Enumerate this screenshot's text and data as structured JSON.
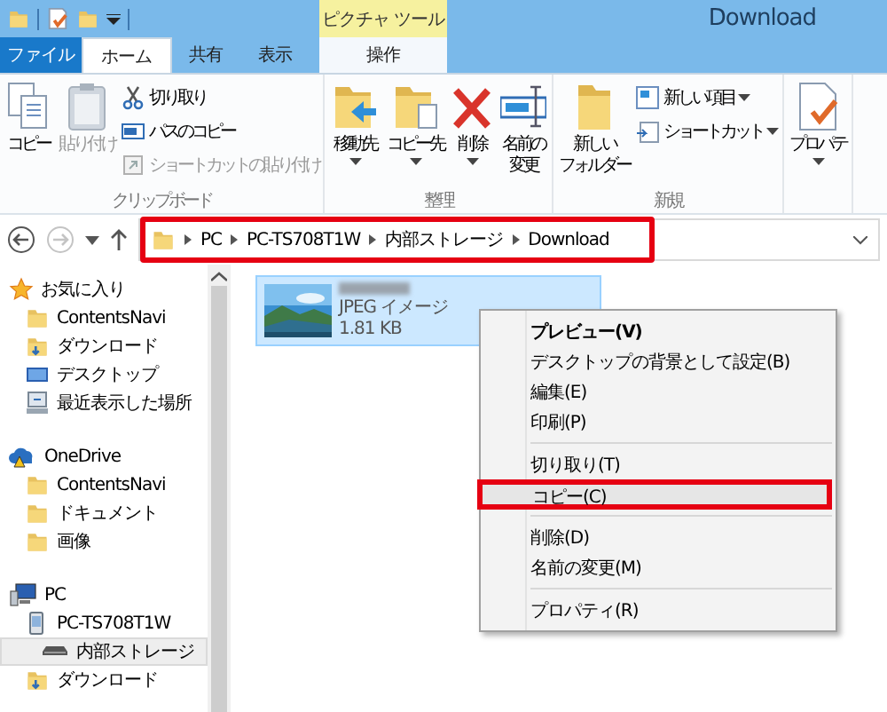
{
  "title_bar": {
    "title": "Download",
    "context_group": "ピクチャ ツール"
  },
  "tabs": [
    {
      "label": "ファイル",
      "kind": "file",
      "selected": false
    },
    {
      "label": "ホーム",
      "kind": "normal",
      "selected": true
    },
    {
      "label": "共有",
      "kind": "normal",
      "selected": false
    },
    {
      "label": "表示",
      "kind": "normal",
      "selected": false
    },
    {
      "label": "操作",
      "kind": "contextual",
      "selected": false
    }
  ],
  "ribbon": {
    "groups": [
      {
        "label": "クリップボード",
        "items": [
          {
            "label": "コピー",
            "kind": "large",
            "disabled": false,
            "has_menu": false
          },
          {
            "label": "貼り付け",
            "kind": "large",
            "disabled": true,
            "has_menu": false
          },
          {
            "label": "切り取り",
            "kind": "small",
            "disabled": false,
            "has_menu": false
          },
          {
            "label": "パスのコピー",
            "kind": "small",
            "disabled": false,
            "has_menu": false
          },
          {
            "label": "ショートカットの貼り付け",
            "kind": "small",
            "disabled": true,
            "has_menu": false
          }
        ]
      },
      {
        "label": "整理",
        "items": [
          {
            "label": "移動先",
            "kind": "large",
            "disabled": false,
            "has_menu": true
          },
          {
            "label": "コピー先",
            "kind": "large",
            "disabled": false,
            "has_menu": true
          },
          {
            "label": "削除",
            "kind": "large",
            "disabled": false,
            "has_menu": true
          },
          {
            "lines": [
              "名前の",
              "変更"
            ],
            "kind": "large",
            "disabled": false,
            "has_menu": false
          }
        ]
      },
      {
        "label": "新規",
        "items": [
          {
            "lines": [
              "新しい",
              "フォルダー"
            ],
            "kind": "large",
            "disabled": false,
            "has_menu": false
          },
          {
            "label": "新しい項目",
            "kind": "small",
            "disabled": false,
            "has_menu": true
          },
          {
            "label": "ショートカット",
            "kind": "small",
            "disabled": false,
            "has_menu": true
          }
        ]
      },
      {
        "items": [
          {
            "label": "プロパテ",
            "kind": "large",
            "disabled": false,
            "has_menu": true
          }
        ]
      }
    ]
  },
  "nav_buttons": [
    {
      "kind": "back",
      "disabled": false
    },
    {
      "kind": "forward",
      "disabled": true
    },
    {
      "kind": "recent",
      "disabled": false
    },
    {
      "kind": "up",
      "disabled": false
    }
  ],
  "address_bar": {
    "crumbs": [
      "PC",
      "PC-TS708T1W",
      "内部ストレージ",
      "Download"
    ],
    "annotated": true
  },
  "navigation": {
    "tree": [
      {
        "label": "お気に入り",
        "kind": "favorites",
        "selected": false,
        "children": [
          {
            "label": "ContentsNavi",
            "kind": "folder",
            "selected": false
          },
          {
            "label": "ダウンロード",
            "kind": "download",
            "selected": false
          },
          {
            "label": "デスクトップ",
            "kind": "desktop",
            "selected": false
          },
          {
            "label": "最近表示した場所",
            "kind": "recent",
            "selected": false
          }
        ]
      },
      {
        "label": "OneDrive",
        "kind": "cloud",
        "selected": false,
        "children": [
          {
            "label": "ContentsNavi",
            "kind": "folder",
            "selected": false
          },
          {
            "label": "ドキュメント",
            "kind": "folder",
            "selected": false
          },
          {
            "label": "画像",
            "kind": "folder",
            "selected": false
          }
        ]
      },
      {
        "label": "PC",
        "kind": "pc",
        "selected": false,
        "children": [
          {
            "label": "PC-TS708T1W",
            "kind": "device",
            "selected": false,
            "children": [
              {
                "label": "内部ストレージ",
                "kind": "drive",
                "selected": true
              }
            ]
          },
          {
            "label": "ダウンロード",
            "kind": "download",
            "selected": false
          }
        ]
      }
    ]
  },
  "file": {
    "type": "JPEG イメージ",
    "size": "1.81 KB",
    "selected": true
  },
  "context_menu": {
    "groups": [
      [
        {
          "label": "プレビュー(V)",
          "default": true,
          "selected": false,
          "annotated": false
        },
        {
          "label": "デスクトップの背景として設定(B)",
          "default": false,
          "selected": false,
          "annotated": false
        },
        {
          "label": "編集(E)",
          "default": false,
          "selected": false,
          "annotated": false
        },
        {
          "label": "印刷(P)",
          "default": false,
          "selected": false,
          "annotated": false
        }
      ],
      [
        {
          "label": "切り取り(T)",
          "default": false,
          "selected": false,
          "annotated": false
        },
        {
          "label": "コピー(C)",
          "default": false,
          "selected": true,
          "annotated": true
        }
      ],
      [
        {
          "label": "削除(D)",
          "default": false,
          "selected": false,
          "annotated": false
        },
        {
          "label": "名前の変更(M)",
          "default": false,
          "selected": false,
          "annotated": false
        }
      ],
      [
        {
          "label": "プロパティ(R)",
          "default": false,
          "selected": false,
          "annotated": false
        }
      ]
    ]
  }
}
